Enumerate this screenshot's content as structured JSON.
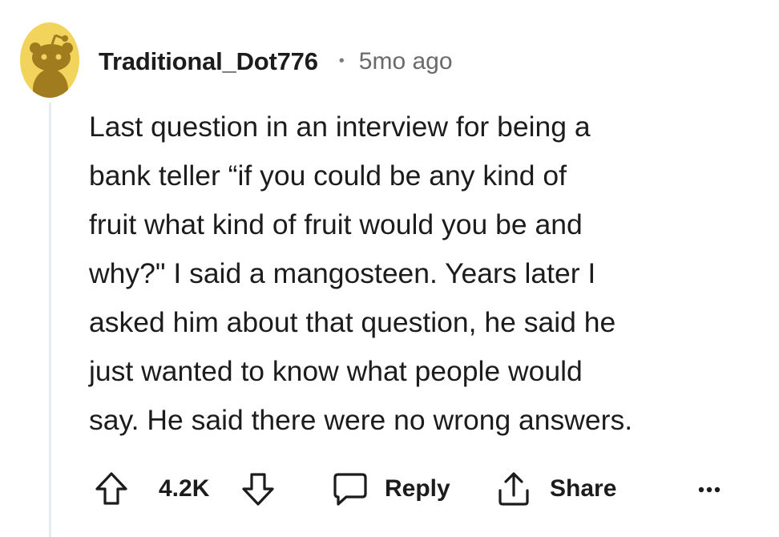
{
  "comment": {
    "username": "Traditional_Dot776",
    "separator": "•",
    "timestamp": "5mo ago",
    "avatar_icon": "snoo-avatar-icon",
    "avatar_color": "#f2d35b",
    "body_lines": [
      "Last question in an interview for being a",
      "bank teller “if you could be any kind of",
      "fruit what kind of fruit would you be and",
      "why?\" I said a mangosteen. Years later I",
      "asked him about that question, he said he",
      "just wanted to know what people would",
      "say. He said there were no wrong answers."
    ]
  },
  "actions": {
    "upvote_icon": "upvote-arrow-icon",
    "score": "4.2K",
    "downvote_icon": "downvote-arrow-icon",
    "reply_icon": "speech-bubble-icon",
    "reply_label": "Reply",
    "share_icon": "share-upload-icon",
    "share_label": "Share",
    "more_icon": "more-options-icon"
  }
}
